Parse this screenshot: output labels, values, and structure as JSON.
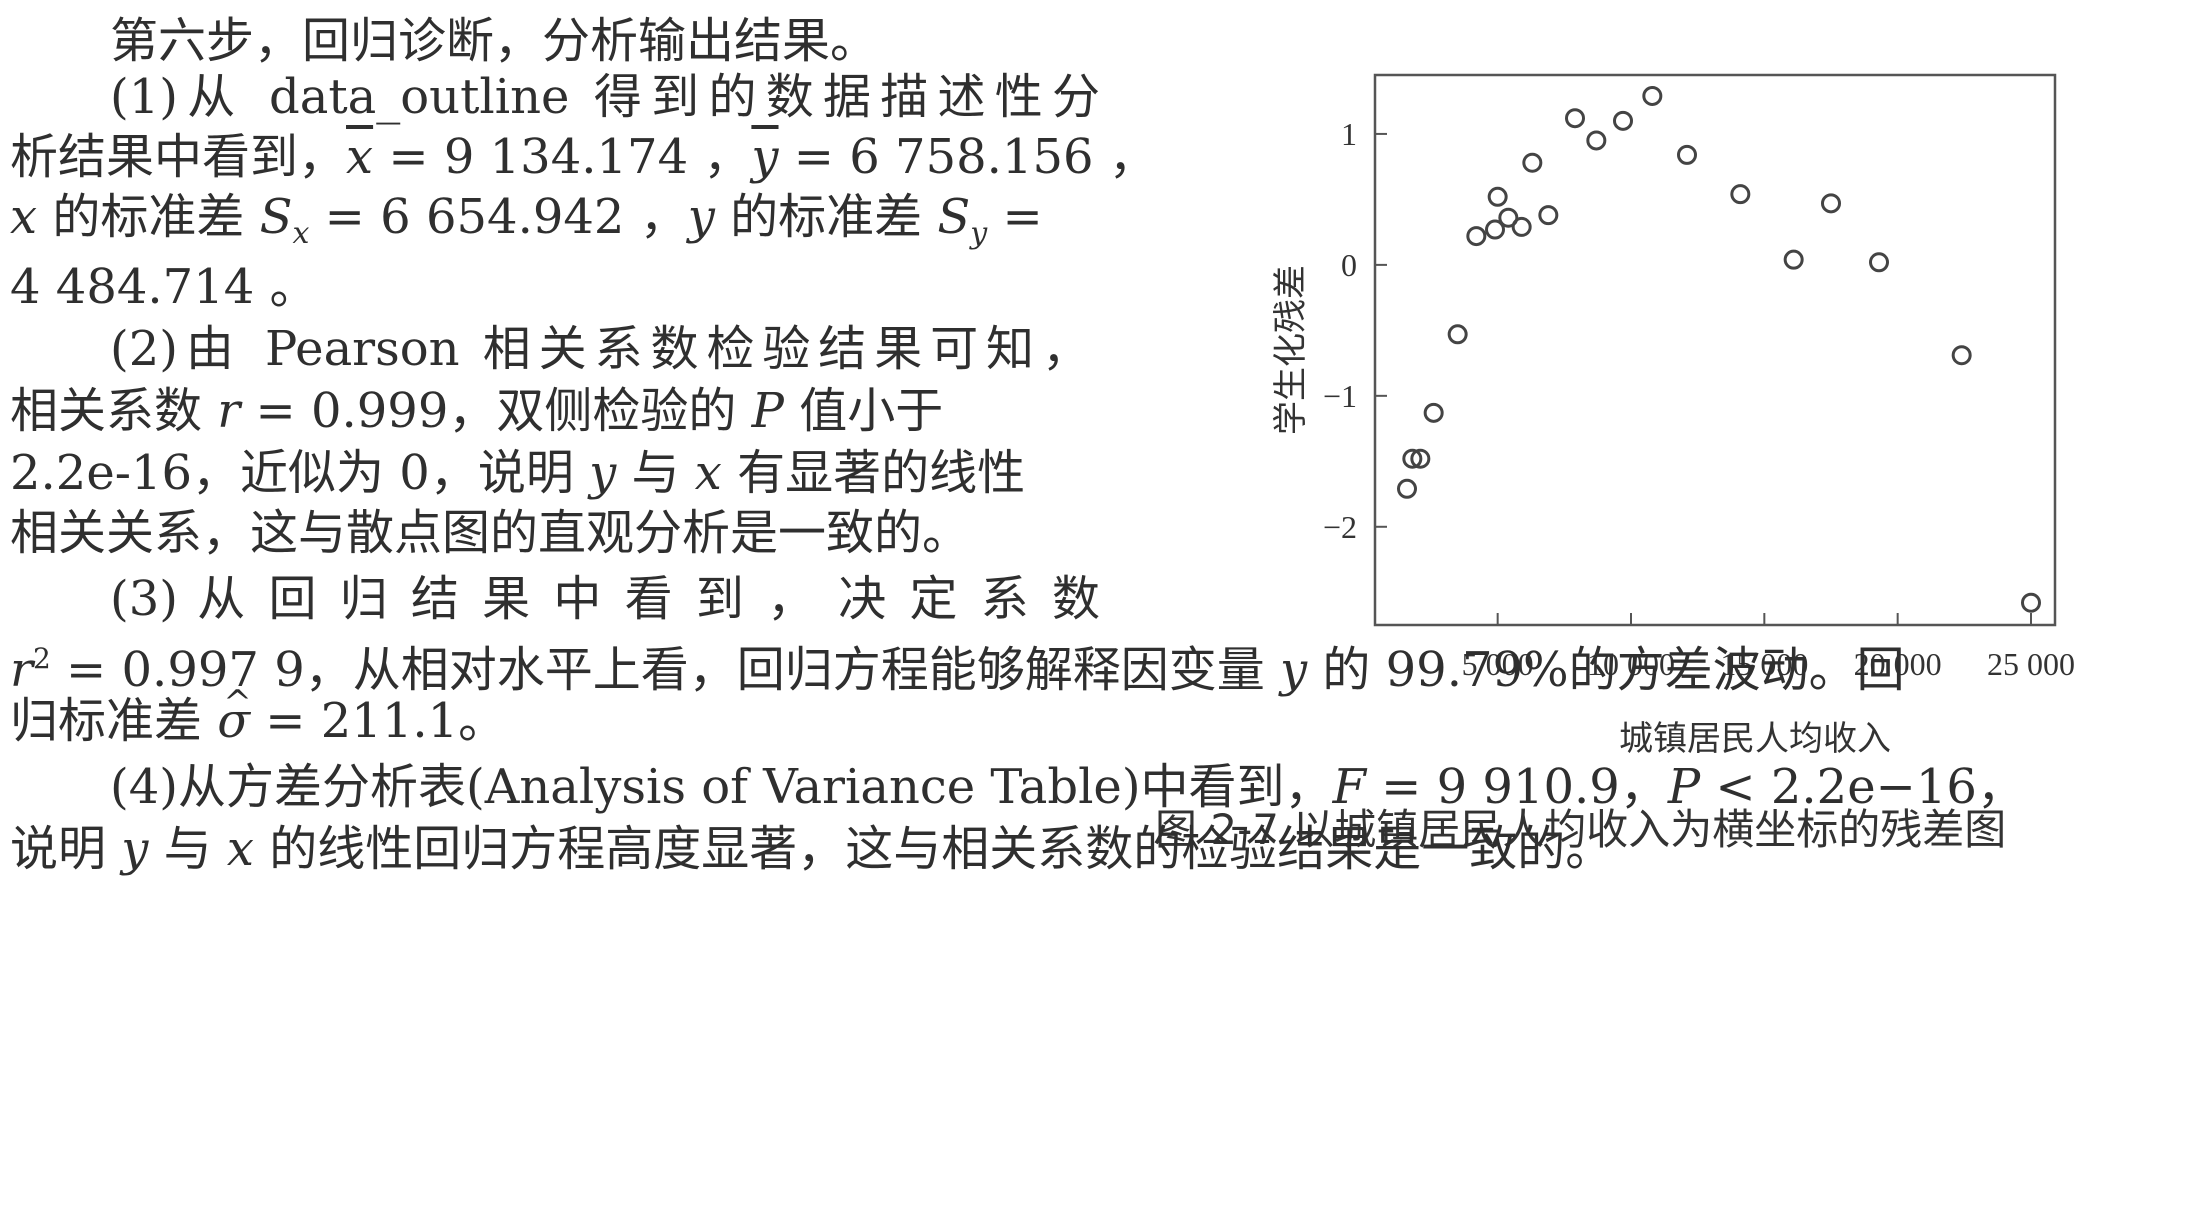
{
  "text": {
    "step_title": "第六步，回归诊断，分析输出结果。",
    "p1a": "(1)从 data_outline 得到的数据描述性分",
    "p1b_pre": "析结果中看到，",
    "p1b_x": "x",
    "p1b_mid1": " = 9 134.174 ，",
    "p1b_y": "y",
    "p1b_mid2": " = 6 758.156 ，",
    "p1c_x": "x",
    "p1c_mid1": " 的标准差 ",
    "p1c_S": "S",
    "p1c_sub1": "x",
    "p1c_mid2": " = 6 654.942 ，",
    "p1c_y": "y",
    "p1c_mid3": " 的标准差 ",
    "p1c_S2": "S",
    "p1c_sub2": "y",
    "p1c_end": " =",
    "p1d": "4 484.714 。",
    "p2a": "(2)由 Pearson 相关系数检验结果可知，",
    "p2b_pre": "相关系数 ",
    "p2b_r": "r",
    "p2b_mid": " = 0.999，双侧检验的 ",
    "p2b_P": "P",
    "p2b_end": " 值小于",
    "p2c_pre": "2.2e-16，近似为 0，说明 ",
    "p2c_y": "y",
    "p2c_mid": " 与 ",
    "p2c_x": "x",
    "p2c_end": " 有显著的线性",
    "p2d": "相关关系，这与散点图的直观分析是一致的。",
    "p3a": "(3) 从 回 归 结 果 中 看 到 ， 决 定 系 数",
    "p3b_r": "r",
    "p3b_sup": "2",
    "p3b_mid": " = 0.997 9，从相对水平上看，回归方程能够解释因变量 ",
    "p3b_y": "y",
    "p3b_end": " 的 99.79%的方差波动。回",
    "p3c_pre": "归标准差 ",
    "p3c_sigma": "σ",
    "p3c_end": " = 211.1。",
    "p4a_pre": "(4)从方差分析表(Analysis of Variance Table)中看到，",
    "p4a_F": "F",
    "p4a_mid": " = 9 910.9，",
    "p4a_P": "P",
    "p4a_end": " < 2.2e−16，",
    "p4b_pre": "说明 ",
    "p4b_y": "y",
    "p4b_mid": " 与 ",
    "p4b_x": "x",
    "p4b_end": " 的线性回归方程高度显著，这与相关系数的检验结果是一致的。",
    "caption": "图 2-7  以城镇居民人均收入为横坐标的残差图"
  },
  "chart_data": {
    "type": "scatter",
    "xlabel": "城镇居民人均收入",
    "ylabel": "学生化残差",
    "xlim": [
      400,
      25900
    ],
    "ylim": [
      -2.75,
      1.45
    ],
    "xticks": [
      5000,
      10000,
      15000,
      20000,
      25000
    ],
    "xtick_labels": [
      "5 000",
      "10 000",
      "15 000",
      "20 000",
      "25 000"
    ],
    "yticks": [
      1,
      0,
      -1,
      -2
    ],
    "ytick_labels": [
      "1",
      "0",
      "−1",
      "−2"
    ],
    "grid": false,
    "points": [
      {
        "x": 1600,
        "y": -1.71
      },
      {
        "x": 1800,
        "y": -1.48
      },
      {
        "x": 2100,
        "y": -1.48
      },
      {
        "x": 2600,
        "y": -1.13
      },
      {
        "x": 3500,
        "y": -0.53
      },
      {
        "x": 4200,
        "y": 0.22
      },
      {
        "x": 4900,
        "y": 0.27
      },
      {
        "x": 5000,
        "y": 0.52
      },
      {
        "x": 5400,
        "y": 0.36
      },
      {
        "x": 5900,
        "y": 0.29
      },
      {
        "x": 6300,
        "y": 0.78
      },
      {
        "x": 6900,
        "y": 0.38
      },
      {
        "x": 7900,
        "y": 1.12
      },
      {
        "x": 8700,
        "y": 0.95
      },
      {
        "x": 9700,
        "y": 1.1
      },
      {
        "x": 10800,
        "y": 1.29
      },
      {
        "x": 12100,
        "y": 0.84
      },
      {
        "x": 14100,
        "y": 0.54
      },
      {
        "x": 16100,
        "y": 0.04
      },
      {
        "x": 17500,
        "y": 0.47
      },
      {
        "x": 19300,
        "y": 0.02
      },
      {
        "x": 22400,
        "y": -0.69
      },
      {
        "x": 25000,
        "y": -2.58
      }
    ]
  }
}
